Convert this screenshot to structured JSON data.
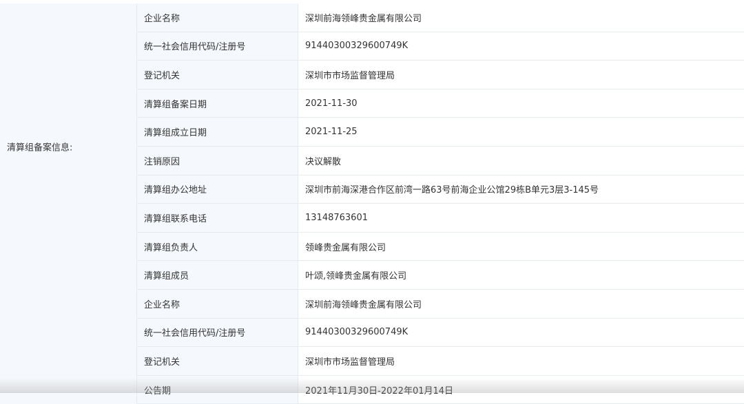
{
  "sections": [
    {
      "label": "清算组备案信息:",
      "rows": [
        {
          "key": "企业名称",
          "value": "深圳前海领峰贵金属有限公司"
        },
        {
          "key": "统一社会信用代码/注册号",
          "value": "91440300329600749K"
        },
        {
          "key": "登记机关",
          "value": "深圳市市场监督管理局"
        },
        {
          "key": "清算组备案日期",
          "value": "2021-11-30"
        },
        {
          "key": "清算组成立日期",
          "value": "2021-11-25"
        },
        {
          "key": "注销原因",
          "value": "决议解散"
        },
        {
          "key": "清算组办公地址",
          "value": "深圳市前海深港合作区前湾一路63号前海企业公馆29栋B单元3层3-145号"
        },
        {
          "key": "清算组联系电话",
          "value": "13148763601"
        },
        {
          "key": "清算组负责人",
          "value": "领峰贵金属有限公司"
        },
        {
          "key": "清算组成员",
          "value": "叶颂,领峰贵金属有限公司"
        }
      ]
    },
    {
      "label": "",
      "rows": [
        {
          "key": "企业名称",
          "value": "深圳前海领峰贵金属有限公司"
        },
        {
          "key": "统一社会信用代码/注册号",
          "value": "91440300329600749K"
        },
        {
          "key": "登记机关",
          "value": "深圳市市场监督管理局"
        },
        {
          "key": "公告期",
          "value": "2021年11月30日-2022年01月14日"
        }
      ]
    }
  ]
}
